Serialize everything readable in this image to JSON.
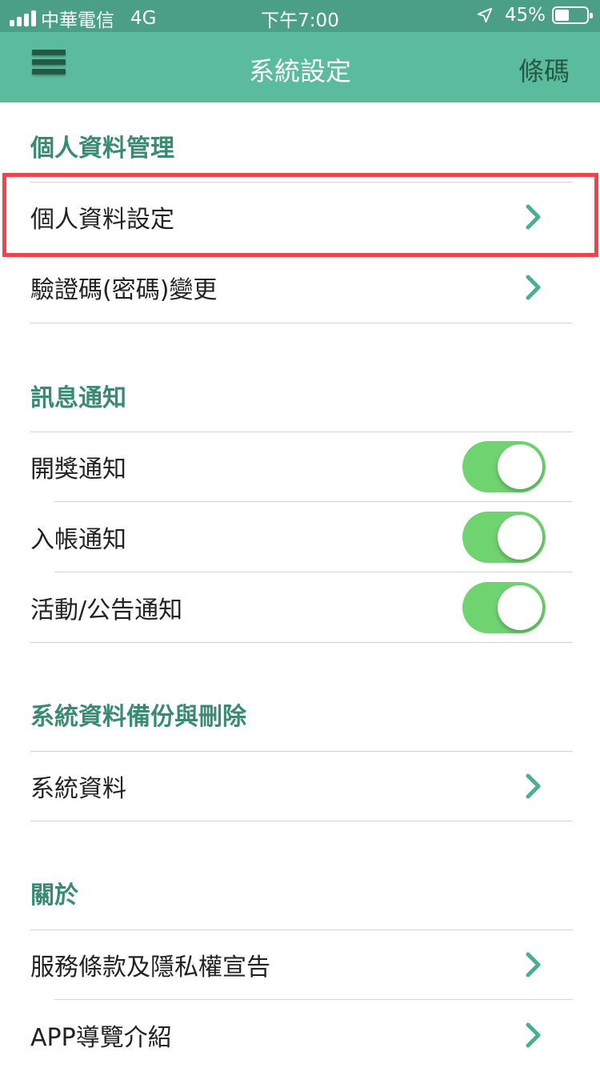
{
  "status_bar": {
    "carrier": "中華電信",
    "network": "4G",
    "time": "下午7:00",
    "battery": "45%",
    "battery_level": 0.45
  },
  "nav": {
    "title": "系統設定",
    "right_label": "條碼",
    "menu_icon": "hamburger-icon"
  },
  "sections": {
    "personal": {
      "header": "個人資料管理",
      "items": [
        "個人資料設定",
        "驗證碼(密碼)變更"
      ]
    },
    "notifications": {
      "header": "訊息通知",
      "items": [
        {
          "label": "開獎通知",
          "on": true
        },
        {
          "label": "入帳通知",
          "on": true
        },
        {
          "label": "活動/公告通知",
          "on": true
        }
      ]
    },
    "backup": {
      "header": "系統資料備份與刪除",
      "items": [
        "系統資料"
      ]
    },
    "about": {
      "header": "關於",
      "items": [
        "服務條款及隱私權宣告",
        "APP導覽介紹"
      ]
    }
  },
  "colors": {
    "status_bar": "#4a9f84",
    "nav_bar": "#5bbc9d",
    "section_header": "#3a8a72",
    "toggle_on": "#6fd36f",
    "chevron": "#4aae93",
    "highlight": "#f0434a"
  }
}
